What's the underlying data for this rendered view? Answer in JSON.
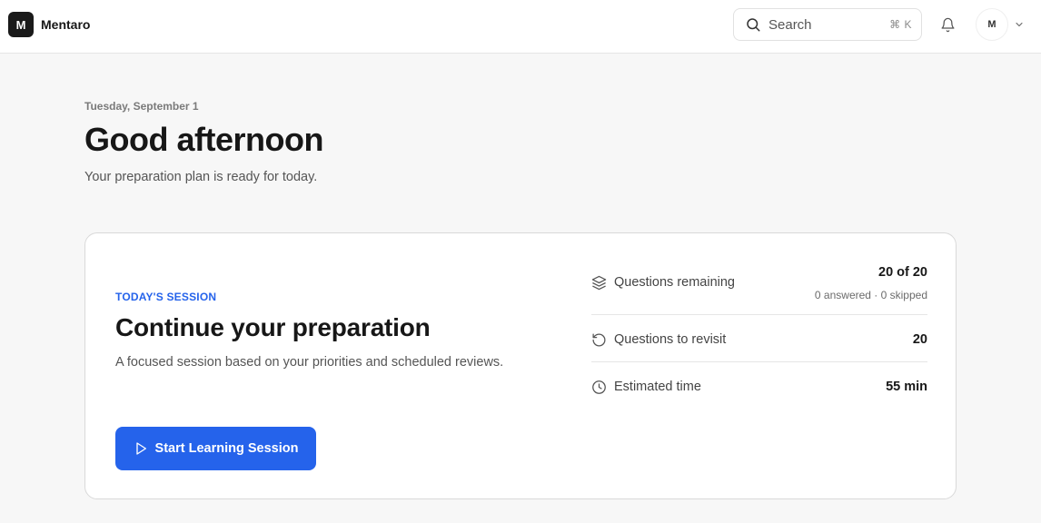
{
  "app": {
    "logo_letter": "M",
    "name": "Mentaro"
  },
  "search": {
    "label": "Search",
    "shortcut": "⌘ K"
  },
  "user": {
    "initial": "M"
  },
  "header": {
    "date": "Tuesday, September 1",
    "greeting": "Good afternoon",
    "subtitle": "Your preparation plan is ready for today."
  },
  "session": {
    "tag": "TODAY'S SESSION",
    "title": "Continue your preparation",
    "description": "A focused session based on your priorities and scheduled reviews.",
    "start_label": "Start Learning Session"
  },
  "stats": {
    "remaining": {
      "label": "Questions remaining",
      "value": "20 of 20",
      "sub": "0 answered · 0 skipped"
    },
    "revisit": {
      "label": "Questions to revisit",
      "value": "20"
    },
    "time": {
      "label": "Estimated time",
      "value": "55 min"
    }
  },
  "icons": {
    "search": "search-icon",
    "bell": "bell-icon",
    "chevron": "chevron-down-icon",
    "play": "play-icon",
    "layers": "layers-icon",
    "revisit": "rotate-ccw-icon",
    "clock": "clock-icon"
  },
  "colors": {
    "accent": "#2563eb",
    "logo_bg": "#1a1a1a",
    "background": "#f7f7f7"
  }
}
